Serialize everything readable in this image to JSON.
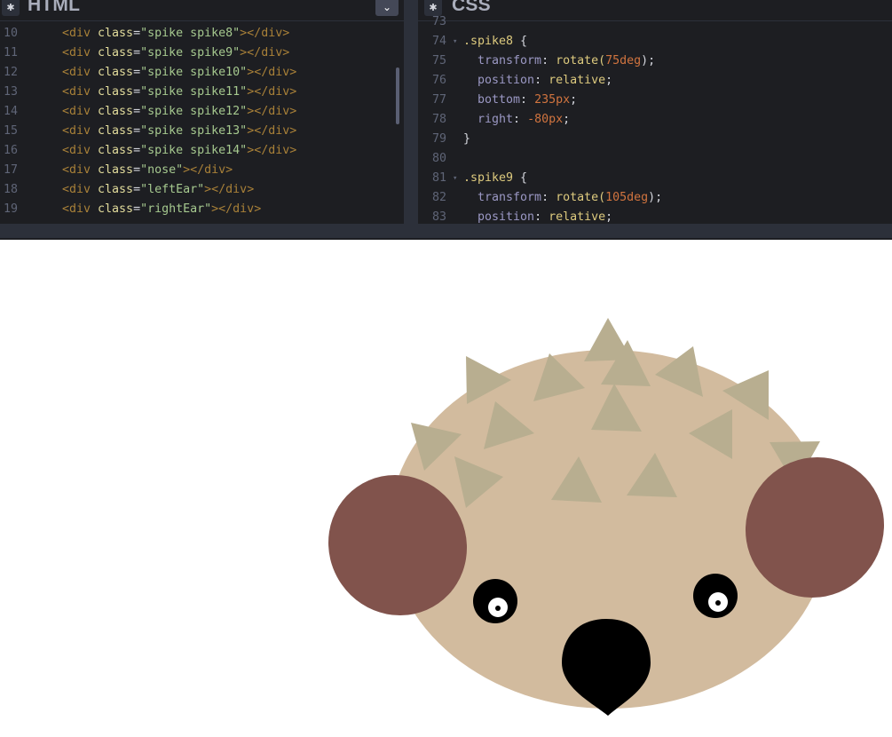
{
  "html_panel": {
    "title": "HTML",
    "gear_icon": "gear-icon",
    "collapse_icon": "chevron-down-icon",
    "lines": [
      {
        "num": "10",
        "class_value": "\"spike spike8\""
      },
      {
        "num": "11",
        "class_value": "\"spike spike9\""
      },
      {
        "num": "12",
        "class_value": "\"spike spike10\""
      },
      {
        "num": "13",
        "class_value": "\"spike spike11\""
      },
      {
        "num": "14",
        "class_value": "\"spike spike12\""
      },
      {
        "num": "15",
        "class_value": "\"spike spike13\""
      },
      {
        "num": "16",
        "class_value": "\"spike spike14\""
      },
      {
        "num": "17",
        "class_value": "\"nose\""
      },
      {
        "num": "18",
        "class_value": "\"leftEar\""
      },
      {
        "num": "19",
        "class_value": "\"rightEar\""
      }
    ],
    "tag_open": "<div",
    "attr": " class",
    "eq": "=",
    "tag_close": "></div>"
  },
  "css_panel": {
    "title": "CSS",
    "gear_icon": "gear-icon",
    "lines": [
      {
        "num": "73"
      },
      {
        "num": "74",
        "fold": "▾",
        "selector": ".spike8",
        "brace": " {"
      },
      {
        "num": "75",
        "prop": "transform",
        "value": "rotate(",
        "num_val": "75deg",
        "after": ");"
      },
      {
        "num": "76",
        "prop": "position",
        "value": "relative",
        "after": ";"
      },
      {
        "num": "77",
        "prop": "bottom",
        "num_val": "235px",
        "after": ";"
      },
      {
        "num": "78",
        "prop": "right",
        "num_val": "-80px",
        "after": ";"
      },
      {
        "num": "79",
        "brace": "}"
      },
      {
        "num": "80"
      },
      {
        "num": "81",
        "fold": "▾",
        "selector": ".spike9",
        "brace": " {"
      },
      {
        "num": "82",
        "prop": "transform",
        "value": "rotate(",
        "num_val": "105deg",
        "after": ");"
      },
      {
        "num": "83",
        "prop": "position",
        "value": "relative",
        "after": ";"
      }
    ]
  },
  "preview": {
    "colors": {
      "face": "#d2bb9e",
      "spike": "#b8ae90",
      "ear": "#81534c",
      "eye": "#000000",
      "pupil": "#ffffff",
      "nose": "#000000"
    }
  }
}
